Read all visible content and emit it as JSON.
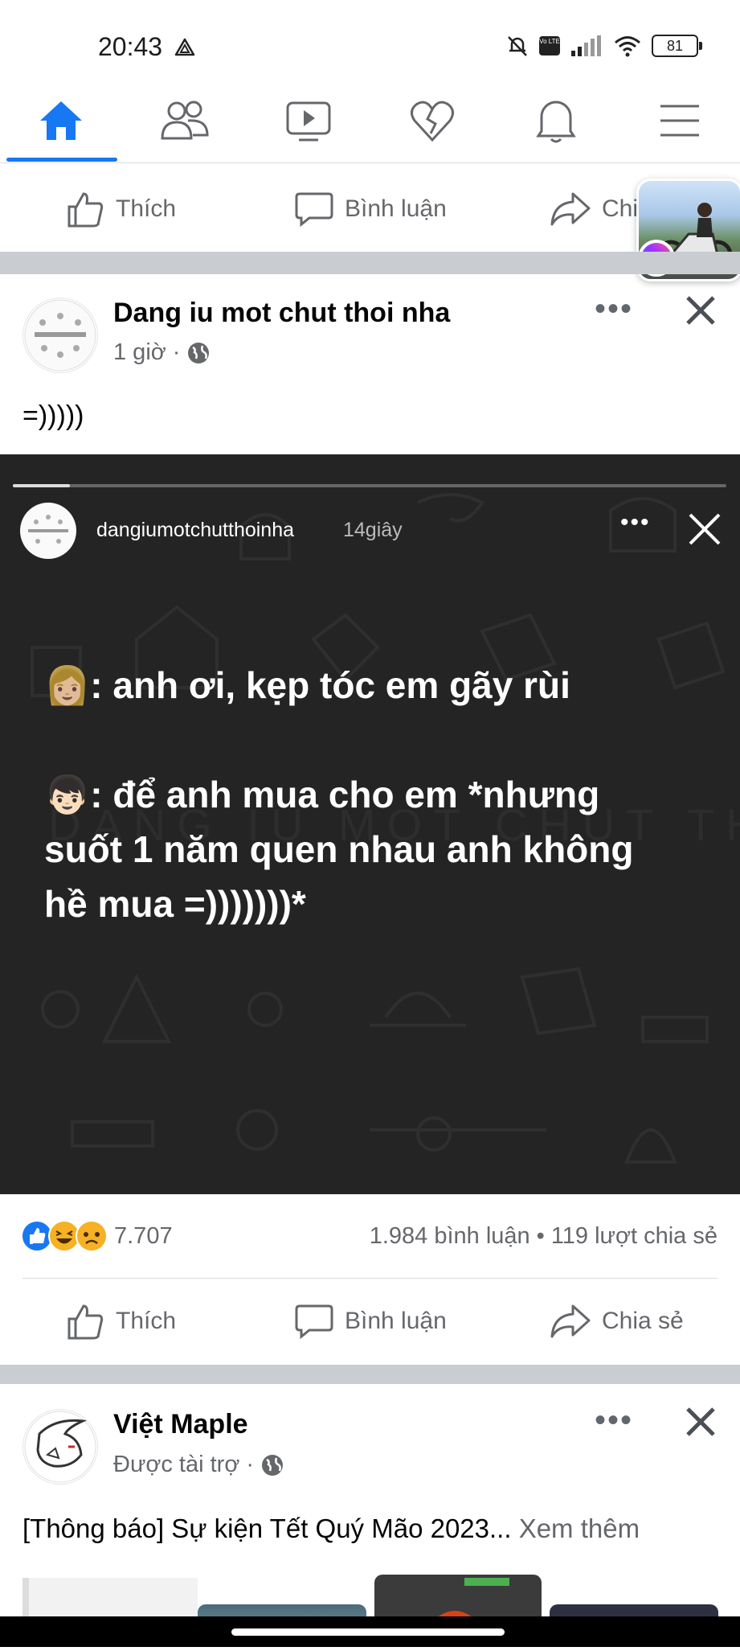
{
  "status": {
    "time": "20:43",
    "battery": "81",
    "volte": "Vo LTE"
  },
  "nav": {
    "items": [
      {
        "name": "home",
        "active": true
      },
      {
        "name": "friends"
      },
      {
        "name": "watch"
      },
      {
        "name": "dating"
      },
      {
        "name": "notifications"
      },
      {
        "name": "menu"
      }
    ]
  },
  "prev_post_actions": {
    "like": "Thích",
    "comment": "Bình luận",
    "share": "Chia sẻ"
  },
  "post": {
    "page_name": "Dang iu mot chut thoi nha",
    "time": "1 giờ",
    "dot": "·",
    "caption": "=)))))",
    "story": {
      "username": "dangiumotchutthoinha",
      "time": "14giây",
      "line1": "👩🏼: anh ơi, kẹp tóc em gãy rùi",
      "line2": "👦🏻: để anh mua cho em *nhưng",
      "line3": "suốt 1 năm quen nhau anh không",
      "line4": "hề mua =)))))))*",
      "watermark": "DANG IU MOT CHUT THOI NHA"
    },
    "reactions_count": "7.707",
    "comments": "1.984 bình luận",
    "bullet": "•",
    "shares": "119 lượt chia sẻ",
    "actions": {
      "like": "Thích",
      "comment": "Bình luận",
      "share": "Chia sẻ"
    }
  },
  "next_post": {
    "page_name": "Việt Maple",
    "sponsored": "Được tài trợ",
    "dot": "·",
    "text": "[Thông báo] Sự kiện Tết Quý Mão 2023...",
    "see_more": "Xem thêm"
  },
  "colors": {
    "brand": "#1877f2",
    "story_bg": "#242424",
    "muted": "#65676b",
    "separator": "#c9ccd1"
  }
}
